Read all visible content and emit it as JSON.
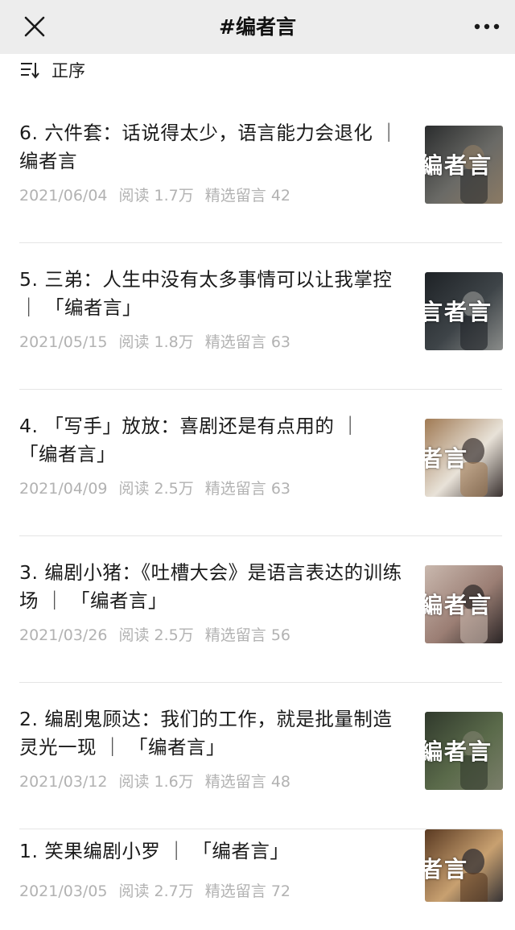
{
  "header": {
    "title": "#编者言"
  },
  "sort": {
    "label": "正序"
  },
  "articles": [
    {
      "title": "6. 六件套：话说得太少，语言能力会退化 ｜ 编者言",
      "date": "2021/06/04",
      "reads": "阅读 1.7万",
      "comments": "精选留言 42",
      "thumb_text": "編者言",
      "thumb_colors": [
        "#2b2d2e",
        "#6a6a66",
        "#8b7a64"
      ]
    },
    {
      "title": "5. 三弟：人生中没有太多事情可以让我掌控 ｜ 「编者言」",
      "date": "2021/05/15",
      "reads": "阅读 1.8万",
      "comments": "精选留言 63",
      "thumb_text": "言者言",
      "thumb_colors": [
        "#1e2226",
        "#3e4448",
        "#8a8c8a"
      ]
    },
    {
      "title": "4. 「写手」放放：喜剧还是有点用的 ｜ 「编者言」",
      "date": "2021/04/09",
      "reads": "阅读 2.5万",
      "comments": "精选留言 63",
      "thumb_text": "者言",
      "thumb_colors": [
        "#a07a54",
        "#e8e2d8",
        "#3a3230"
      ]
    },
    {
      "title": "3. 编剧小猪：《吐槽大会》是语言表达的训练场 ｜ 「编者言」",
      "date": "2021/03/26",
      "reads": "阅读 2.5万",
      "comments": "精选留言 56",
      "thumb_text": "編者言",
      "thumb_colors": [
        "#c9b8ae",
        "#9b7e74",
        "#2b2626"
      ]
    },
    {
      "title": "2. 编剧鬼顾达：我们的工作，就是批量制造灵光一现 ｜ 「编者言」",
      "date": "2021/03/12",
      "reads": "阅读 1.6万",
      "comments": "精选留言 48",
      "thumb_text": "編者言",
      "thumb_colors": [
        "#30392c",
        "#5a6a4a",
        "#7a7e6a"
      ]
    },
    {
      "title": "1. 笑果编剧小罗 ｜ 「编者言」",
      "date": "2021/03/05",
      "reads": "阅读 2.7万",
      "comments": "精选留言 72",
      "thumb_text": "者言",
      "thumb_colors": [
        "#5a3a22",
        "#c8a070",
        "#2a2a30"
      ]
    }
  ]
}
